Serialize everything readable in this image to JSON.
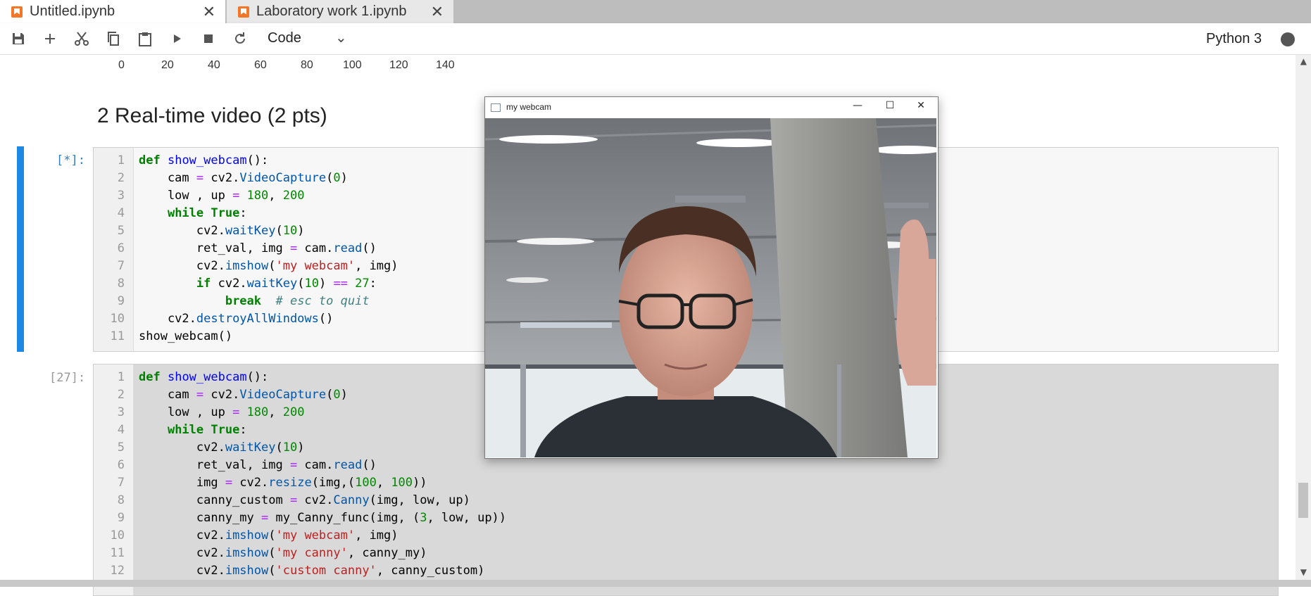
{
  "tabs": [
    {
      "label": "Untitled.ipynb",
      "active": true
    },
    {
      "label": "Laboratory work 1.ipynb",
      "active": false
    }
  ],
  "toolbar": {
    "cell_type": "Code",
    "kernel": "Python 3",
    "icons": [
      "save-icon",
      "add-icon",
      "cut-icon",
      "copy-icon",
      "paste-icon",
      "run-icon",
      "stop-icon",
      "restart-icon"
    ]
  },
  "x_ticks": [
    "0",
    "20",
    "40",
    "60",
    "80",
    "100",
    "120",
    "140"
  ],
  "heading": "2 Real-time video (2 pts)",
  "cell1": {
    "prompt": "[*]:",
    "line_numbers": [
      "1",
      "2",
      "3",
      "4",
      "5",
      "6",
      "7",
      "8",
      "9",
      "10",
      "11"
    ]
  },
  "cell2": {
    "prompt": "[27]:",
    "line_numbers": [
      "1",
      "2",
      "3",
      "4",
      "5",
      "6",
      "7",
      "8",
      "9",
      "10",
      "11",
      "12"
    ]
  },
  "webcam_window": {
    "title": "my webcam",
    "minimize": "—",
    "maximize": "☐",
    "close": "✕"
  },
  "colors": {
    "accent": "#1e88e5",
    "jupyter_orange": "#f37726"
  }
}
